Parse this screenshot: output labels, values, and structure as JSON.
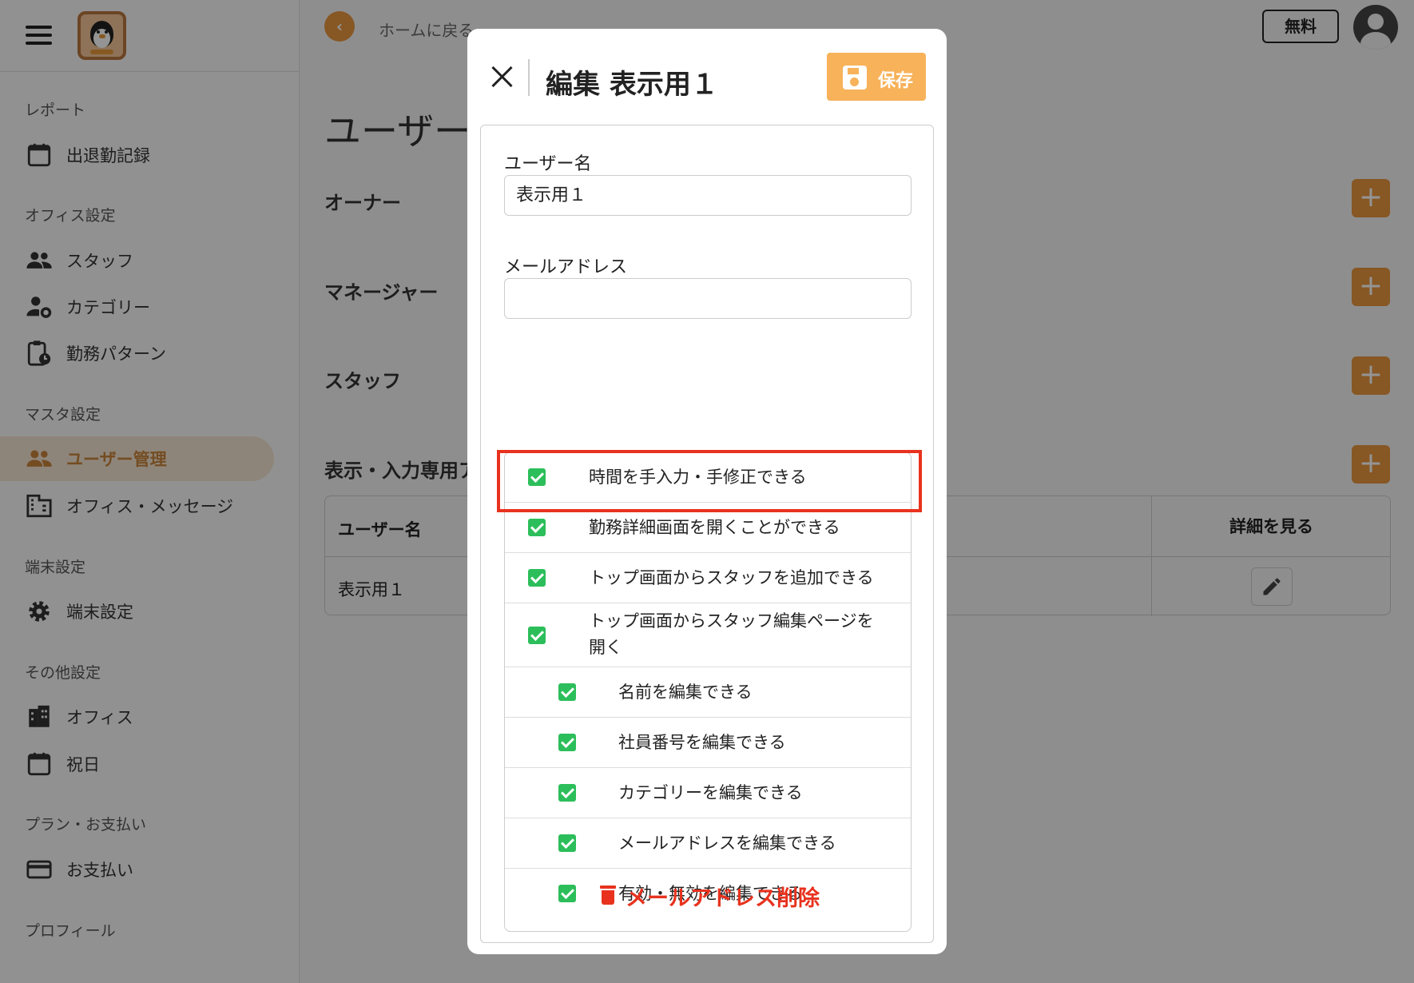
{
  "sidebar": {
    "sections": [
      {
        "label": "レポート",
        "items": [
          {
            "label": "出退勤記録",
            "icon": "calendar-icon"
          }
        ]
      },
      {
        "label": "オフィス設定",
        "items": [
          {
            "label": "スタッフ",
            "icon": "people-icon"
          },
          {
            "label": "カテゴリー",
            "icon": "person-gear-icon"
          },
          {
            "label": "勤務パターン",
            "icon": "clipboard-clock-icon"
          }
        ]
      },
      {
        "label": "マスタ設定",
        "items": [
          {
            "label": "ユーザー管理",
            "icon": "people-icon",
            "active": true
          },
          {
            "label": "オフィス・メッセージ",
            "icon": "building-icon"
          }
        ]
      },
      {
        "label": "端末設定",
        "items": [
          {
            "label": "端末設定",
            "icon": "gear-icon"
          }
        ]
      },
      {
        "label": "その他設定",
        "items": [
          {
            "label": "オフィス",
            "icon": "office-building-icon"
          },
          {
            "label": "祝日",
            "icon": "calendar-icon"
          }
        ]
      },
      {
        "label": "プラン・お支払い",
        "items": [
          {
            "label": "お支払い",
            "icon": "credit-card-icon"
          }
        ]
      },
      {
        "label": "プロフィール",
        "items": []
      }
    ]
  },
  "header": {
    "back_label": "ホームに戻る",
    "plan_badge": "無料"
  },
  "main": {
    "title": "ユーザー",
    "groups": [
      "オーナー",
      "マネージャー",
      "スタッフ",
      "表示・入力専用ア"
    ],
    "table": {
      "col_user": "ユーザー名",
      "col_detail": "詳細を見る",
      "rows": [
        {
          "user": "表示用１"
        }
      ]
    }
  },
  "modal": {
    "title": "編集 表示用１",
    "save_label": "保存",
    "username_label": "ユーザー名",
    "username_value": "表示用１",
    "email_label": "メールアドレス",
    "email_value": "",
    "permissions": [
      {
        "label": "時間を手入力・手修正できる",
        "checked": true,
        "level": 0
      },
      {
        "label": "勤務詳細画面を開くことができる",
        "checked": true,
        "level": 0
      },
      {
        "label": "トップ画面からスタッフを追加できる",
        "checked": true,
        "level": 0
      },
      {
        "label": "トップ画面からスタッフ編集ページを",
        "label2": "開く",
        "checked": true,
        "level": 0
      },
      {
        "label": "名前を編集できる",
        "checked": true,
        "level": 1
      },
      {
        "label": "社員番号を編集できる",
        "checked": true,
        "level": 1
      },
      {
        "label": "カテゴリーを編集できる",
        "checked": true,
        "level": 1
      },
      {
        "label": "メールアドレスを編集できる",
        "checked": true,
        "level": 1
      },
      {
        "label": "有効・無効を編集できる",
        "checked": true,
        "level": 1
      }
    ],
    "delete_label": "メールアドレス削除"
  },
  "colors": {
    "accent": "#e8973f",
    "save": "#f7b25a",
    "check": "#2cbe5a",
    "danger": "#e8321e"
  }
}
